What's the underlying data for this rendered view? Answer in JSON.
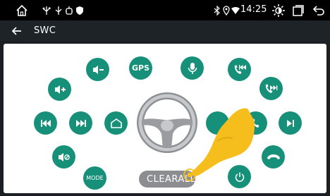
{
  "status": {
    "time": "14:25",
    "icons": [
      "home-icon",
      "usb-icon",
      "usb-icon",
      "android-debug-icon",
      "shield-icon",
      "bluetooth-icon",
      "location-icon",
      "wifi-icon",
      "brightness-icon",
      "recent-apps-icon",
      "back-icon"
    ]
  },
  "titlebar": {
    "title": "SWC",
    "back_icon": "arrow-left-icon"
  },
  "buttons": {
    "gps_label": "GPS",
    "mode_label": "MODE",
    "clear_label": "CLEARALL"
  },
  "colors": {
    "accent": "#17907a",
    "panel": "#ffffff",
    "statusbar": "#000000",
    "titlebar": "#1d2327",
    "hand": "#f6be1d"
  }
}
